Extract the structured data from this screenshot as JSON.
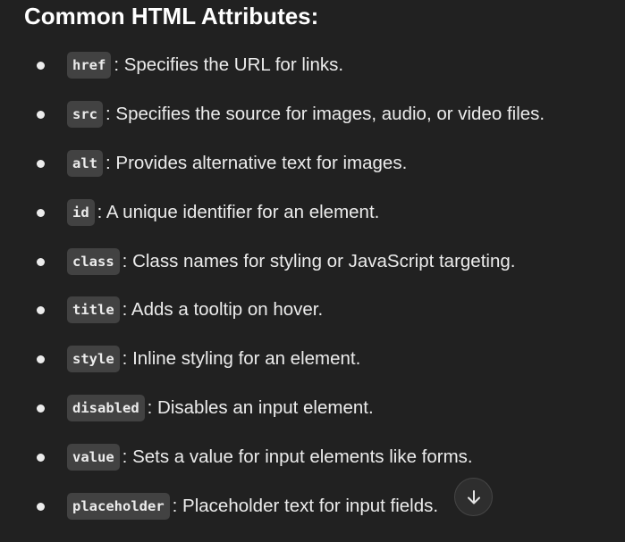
{
  "heading": "Common HTML Attributes:",
  "attributes": [
    {
      "name": "href",
      "description": ": Specifies the URL for links."
    },
    {
      "name": "src",
      "description": ": Specifies the source for images, audio, or video files."
    },
    {
      "name": "alt",
      "description": ": Provides alternative text for images."
    },
    {
      "name": "id",
      "description": ": A unique identifier for an element."
    },
    {
      "name": "class",
      "description": ": Class names for styling or JavaScript targeting."
    },
    {
      "name": "title",
      "description": ": Adds a tooltip on hover."
    },
    {
      "name": "style",
      "description": ": Inline styling for an element."
    },
    {
      "name": "disabled",
      "description": ": Disables an input element."
    },
    {
      "name": "value",
      "description": ": Sets a value for input elements like forms."
    },
    {
      "name": "placeholder",
      "description": ": Placeholder text for input fields."
    }
  ],
  "scroll_button": {
    "icon": "arrow-down-icon"
  },
  "colors": {
    "background": "#212121",
    "text": "#ececec",
    "code_background": "#424242",
    "button_background": "#2f2f2f"
  }
}
